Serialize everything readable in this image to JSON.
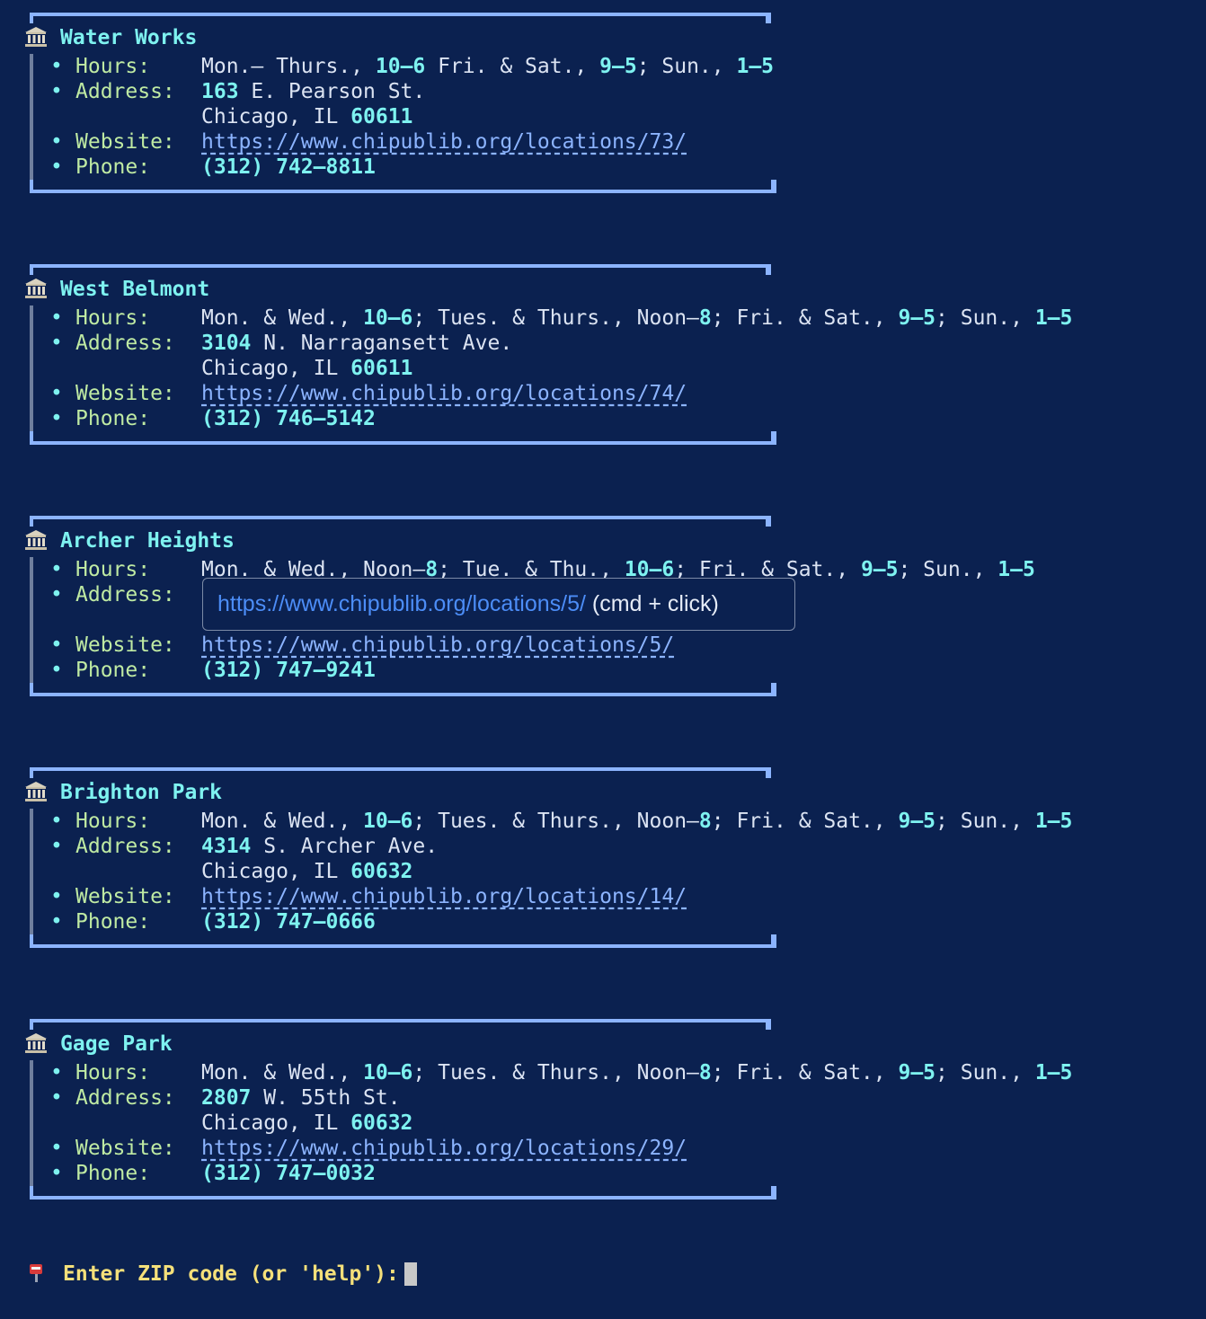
{
  "labels": {
    "hours": "Hours:",
    "address": "Address:",
    "website": "Website:",
    "phone": "Phone:",
    "bullet": "•"
  },
  "icons": {
    "library": "classical-building-icon",
    "prompt": "postbox-icon"
  },
  "colors": {
    "background": "#0b2150",
    "frame": "#8cb4ff",
    "title": "#7ef2f0",
    "label": "#bfeaa3",
    "link": "#8cb4ff",
    "prompt": "#f5e07a"
  },
  "libraries": [
    {
      "name": "Water Works",
      "hours": [
        [
          "Mon.– Thurs., ",
          false
        ],
        [
          "10–6",
          true
        ],
        [
          " Fri. & Sat., ",
          false
        ],
        [
          "9–5",
          true
        ],
        [
          "; Sun., ",
          false
        ],
        [
          "1–5",
          true
        ]
      ],
      "address1": [
        [
          "163",
          true
        ],
        [
          " E. Pearson St.",
          false
        ]
      ],
      "address2": [
        [
          "Chicago, IL ",
          false
        ],
        [
          "60611",
          true
        ]
      ],
      "website": "https://www.chipublib.org/locations/73/",
      "phone": [
        [
          "(312) 742–8811",
          true
        ]
      ]
    },
    {
      "name": "West Belmont",
      "hours": [
        [
          "Mon. & Wed., ",
          false
        ],
        [
          "10–6",
          true
        ],
        [
          "; Tues. & Thurs., Noon–",
          false
        ],
        [
          "8",
          true
        ],
        [
          "; Fri. & Sat., ",
          false
        ],
        [
          "9–5",
          true
        ],
        [
          "; Sun., ",
          false
        ],
        [
          "1–5",
          true
        ]
      ],
      "address1": [
        [
          "3104",
          true
        ],
        [
          " N. Narragansett Ave.",
          false
        ]
      ],
      "address2": [
        [
          "Chicago, IL ",
          false
        ],
        [
          "60611",
          true
        ]
      ],
      "website": "https://www.chipublib.org/locations/74/",
      "phone": [
        [
          "(312) 746–5142",
          true
        ]
      ]
    },
    {
      "name": "Archer Heights",
      "hours": [
        [
          "Mon. & Wed., Noon–",
          false
        ],
        [
          "8",
          true
        ],
        [
          "; Tue. & Thu., ",
          false
        ],
        [
          "10–6",
          true
        ],
        [
          "; Fri. & Sat., ",
          false
        ],
        [
          "9–5",
          true
        ],
        [
          "; Sun., ",
          false
        ],
        [
          "1–5",
          true
        ]
      ],
      "address1": [],
      "address2": [],
      "website": "https://www.chipublib.org/locations/5/",
      "phone": [
        [
          "(312) 747–9241",
          true
        ]
      ]
    },
    {
      "name": "Brighton Park",
      "hours": [
        [
          "Mon. & Wed., ",
          false
        ],
        [
          "10–6",
          true
        ],
        [
          "; Tues. & Thurs., Noon–",
          false
        ],
        [
          "8",
          true
        ],
        [
          "; Fri. & Sat., ",
          false
        ],
        [
          "9–5",
          true
        ],
        [
          "; Sun., ",
          false
        ],
        [
          "1–5",
          true
        ]
      ],
      "address1": [
        [
          "4314",
          true
        ],
        [
          " S. Archer Ave.",
          false
        ]
      ],
      "address2": [
        [
          "Chicago, IL ",
          false
        ],
        [
          "60632",
          true
        ]
      ],
      "website": "https://www.chipublib.org/locations/14/",
      "phone": [
        [
          "(312) 747–0666",
          true
        ]
      ]
    },
    {
      "name": "Gage Park",
      "hours": [
        [
          "Mon. & Wed., ",
          false
        ],
        [
          "10–6",
          true
        ],
        [
          "; Tues. & Thurs., Noon–",
          false
        ],
        [
          "8",
          true
        ],
        [
          "; Fri. & Sat., ",
          false
        ],
        [
          "9–5",
          true
        ],
        [
          "; Sun., ",
          false
        ],
        [
          "1–5",
          true
        ]
      ],
      "address1": [
        [
          "2807",
          true
        ],
        [
          " W. 55th St.",
          false
        ]
      ],
      "address2": [
        [
          "Chicago, IL ",
          false
        ],
        [
          "60632",
          true
        ]
      ],
      "website": "https://www.chipublib.org/locations/29/",
      "phone": [
        [
          "(312) 747–0032",
          true
        ]
      ]
    }
  ],
  "tooltip": {
    "url": "https://www.chipublib.org/locations/5/",
    "hint": " (cmd + click)"
  },
  "prompt": {
    "text": "Enter ZIP code (or 'help'):"
  }
}
